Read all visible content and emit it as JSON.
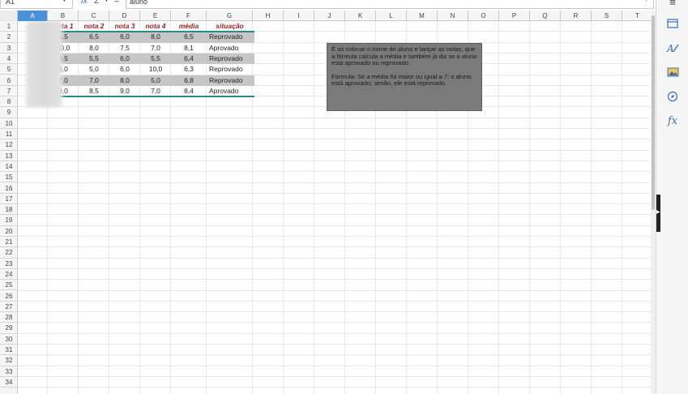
{
  "formula_bar": {
    "cell_ref": "A1",
    "function_icon": "fx",
    "sum_icon": "Σ",
    "equals_icon": "=",
    "content": "aluno"
  },
  "columns": [
    "A",
    "B",
    "C",
    "D",
    "E",
    "F",
    "G",
    "H",
    "I",
    "J",
    "K",
    "L",
    "M",
    "N",
    "O",
    "P",
    "Q",
    "R",
    "S",
    "T"
  ],
  "rows": [
    "1",
    "2",
    "3",
    "4",
    "5",
    "6",
    "7",
    "8",
    "9",
    "10",
    "11",
    "12",
    "13",
    "14",
    "15",
    "16",
    "17",
    "18",
    "19",
    "20",
    "21",
    "22",
    "23",
    "24",
    "25",
    "26",
    "27",
    "28",
    "29",
    "30",
    "31",
    "32",
    "33",
    "34"
  ],
  "table": {
    "headers": [
      "nota 1",
      "nota 2",
      "nota 3",
      "nota 4",
      "média",
      "situação"
    ],
    "rows": [
      [
        "5,5",
        "6,5",
        "6,0",
        "8,0",
        "6,5",
        "Reprovado"
      ],
      [
        "10,0",
        "8,0",
        "7,5",
        "7,0",
        "8,1",
        "Aprovado"
      ],
      [
        "8,5",
        "5,5",
        "6,0",
        "5,5",
        "6,4",
        "Reprovado"
      ],
      [
        "4,0",
        "5,0",
        "6,0",
        "10,0",
        "6,3",
        "Reprovado"
      ],
      [
        "7,0",
        "7,0",
        "8,0",
        "5,0",
        "6,8",
        "Reprovado"
      ],
      [
        "9,0",
        "8,5",
        "9,0",
        "7,0",
        "8,4",
        "Aprovado"
      ]
    ]
  },
  "comment": {
    "paragraph1": "É só colocar o nome do aluno e lançar as notas, que a fórmula calcula a média e também já diz se o aluno está aprovado ou reprovado.",
    "paragraph2": "Fórmula: Se a média foi maior ou igual a 7; o aluno está aprovado; senão, ele está reprovado."
  },
  "sidebar": {
    "icons": [
      "properties-icon",
      "styles-icon",
      "gallery-icon",
      "navigator-icon",
      "functions-icon"
    ],
    "menu_glyph": "≡",
    "functions_glyph": "fx"
  },
  "colors": {
    "header_text": "#9a1f1f",
    "table_border": "#2a8a8a",
    "row_shade": "#c6c6c6",
    "comment_bg": "#7a7a7a",
    "selected_header": "#4a90d9"
  }
}
